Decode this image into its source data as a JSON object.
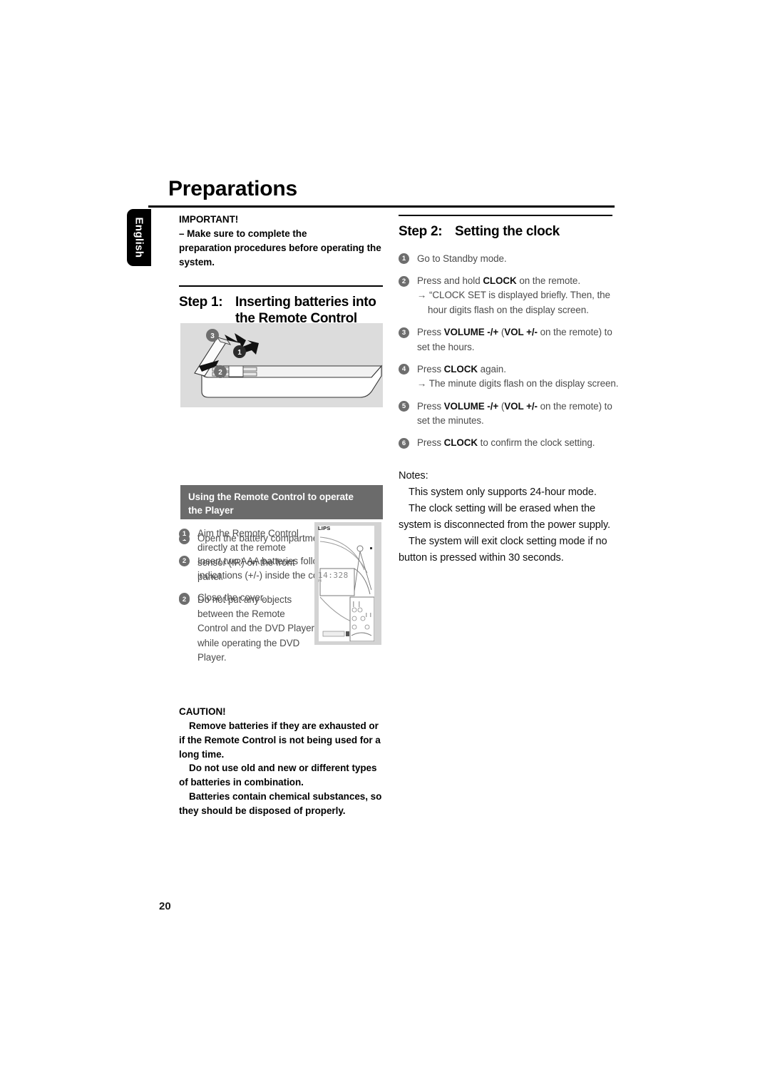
{
  "page": {
    "title": "Preparations",
    "number": "20",
    "language_tab": "English"
  },
  "left_column": {
    "important": {
      "heading": "IMPORTANT!",
      "lines": [
        "–  Make sure to complete the",
        "preparation procedures before operating",
        "the system."
      ]
    },
    "step1": {
      "label": "Step 1:",
      "title_line1": "Inserting batteries into",
      "title_line2": "the Remote Control",
      "figure_alt": "remote-control-battery-compartment",
      "figure_callouts": [
        "1",
        "2",
        "3"
      ],
      "items": [
        {
          "num": "1",
          "text": "Open the battery compartment."
        },
        {
          "num": "2",
          "text": "Insert two AAA batteries following the indications (+/-) inside the compartment."
        },
        {
          "num": "3",
          "text": "Close the cover."
        }
      ]
    },
    "remote_use": {
      "bar_line1": "Using the Remote Control to operate",
      "bar_line2": "the Player",
      "items": [
        {
          "num": "1",
          "text": "Aim the Remote Control directly at the remote sensor (IR) on the front panel."
        },
        {
          "num": "2",
          "text": "Do not put any objects between the Remote Control and the DVD Player while operating the DVD Player."
        }
      ],
      "player_figure": {
        "brand": "LIPS",
        "display": "14:328",
        "display_sub": "PM"
      }
    },
    "caution": {
      "heading": "CAUTION!",
      "paragraphs": [
        "Remove batteries if they are exhausted or if the Remote Control is not being used for a long time.",
        "Do not use old and new or different types of batteries in combination.",
        "Batteries contain chemical substances, so they should be disposed of properly."
      ]
    }
  },
  "right_column": {
    "step2": {
      "label": "Step 2:",
      "title": "Setting the clock",
      "items": [
        {
          "num": "1",
          "text": "Go to Standby mode."
        },
        {
          "num": "2",
          "pre": "Press and hold ",
          "bold": "CLOCK",
          "post": " on the remote.",
          "sub": "→ “CLOCK SET is displayed briefly. Then, the hour digits flash on the display screen."
        },
        {
          "num": "3",
          "pre": "Press ",
          "bold": "VOLUME -/+",
          "mid": " (",
          "bold2": "VOL +/-",
          "post": " on the remote) to set the hours."
        },
        {
          "num": "4",
          "pre": "Press ",
          "bold": "CLOCK",
          "post": " again.",
          "sub": "→ The minute digits flash on the display screen."
        },
        {
          "num": "5",
          "pre": "Press ",
          "bold": "VOLUME -/+",
          "mid": " (",
          "bold2": "VOL +/-",
          "post": " on the remote) to set the minutes."
        },
        {
          "num": "6",
          "pre": "Press ",
          "bold": "CLOCK",
          "post": " to confirm the clock setting."
        }
      ],
      "notes": {
        "label": "Notes:",
        "lines": [
          "This system only supports 24-hour mode.",
          "The clock setting will be erased when the system is disconnected from the power supply.",
          "The system will exit clock setting mode if no button is pressed within 30 seconds."
        ]
      }
    }
  },
  "colors": {
    "bullet_gray": "#6e6e6e",
    "bar_gray": "#6b6b6b",
    "figure_gray": "#dcdcdc",
    "body_text": "#4b4b4b"
  }
}
